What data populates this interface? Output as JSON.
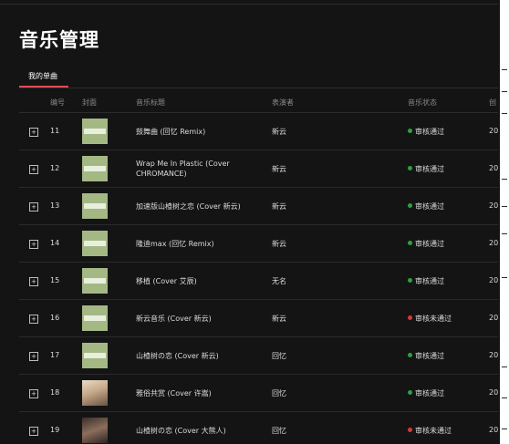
{
  "page": {
    "title": "音乐管理"
  },
  "tabs": [
    {
      "label": "我的单曲",
      "active": true
    }
  ],
  "columns": {
    "number": "编号",
    "cover": "封面",
    "title": "音乐标题",
    "artist": "表演者",
    "status": "音乐状态",
    "date": "创"
  },
  "rows": [
    {
      "num": "11",
      "title": "鼓舞曲 (回忆 Remix)",
      "artist": "新云",
      "status": "审核通过",
      "date": "20",
      "cover": "green"
    },
    {
      "num": "12",
      "title": "Wrap Me In Plastic (Cover CHROMANCE)",
      "artist": "新云",
      "status": "审核通过",
      "date": "20",
      "cover": "green"
    },
    {
      "num": "13",
      "title": "加速版山楂树之恋 (Cover 新云)",
      "artist": "新云",
      "status": "审核通过",
      "date": "20",
      "cover": "green"
    },
    {
      "num": "14",
      "title": "隆迪max (回忆 Remix)",
      "artist": "新云",
      "status": "审核通过",
      "date": "20",
      "cover": "green"
    },
    {
      "num": "15",
      "title": "移植 (Cover 艾辰)",
      "artist": "无名",
      "status": "审核通过",
      "date": "20",
      "cover": "green"
    },
    {
      "num": "16",
      "title": "新云音乐 (Cover 新云)",
      "artist": "新云",
      "status": "审核未通过",
      "date": "20",
      "cover": "green"
    },
    {
      "num": "17",
      "title": "山楂树の恋 (Cover 新云)",
      "artist": "回忆",
      "status": "审核通过",
      "date": "20",
      "cover": "green"
    },
    {
      "num": "18",
      "title": "雅俗共赏 (Cover 许嵩)",
      "artist": "回忆",
      "status": "审核通过",
      "date": "20",
      "cover": "portrait1"
    },
    {
      "num": "19",
      "title": "山楂树の恋 (Cover 大熊人)",
      "artist": "回忆",
      "status": "审核未通过",
      "date": "20",
      "cover": "portrait2"
    }
  ],
  "colors": {
    "background": "#141414",
    "accent": "#e34b5b",
    "status_ok": "#2ea043",
    "status_rejected": "#d93838"
  },
  "icons": {
    "expand": "plus-square-icon"
  }
}
